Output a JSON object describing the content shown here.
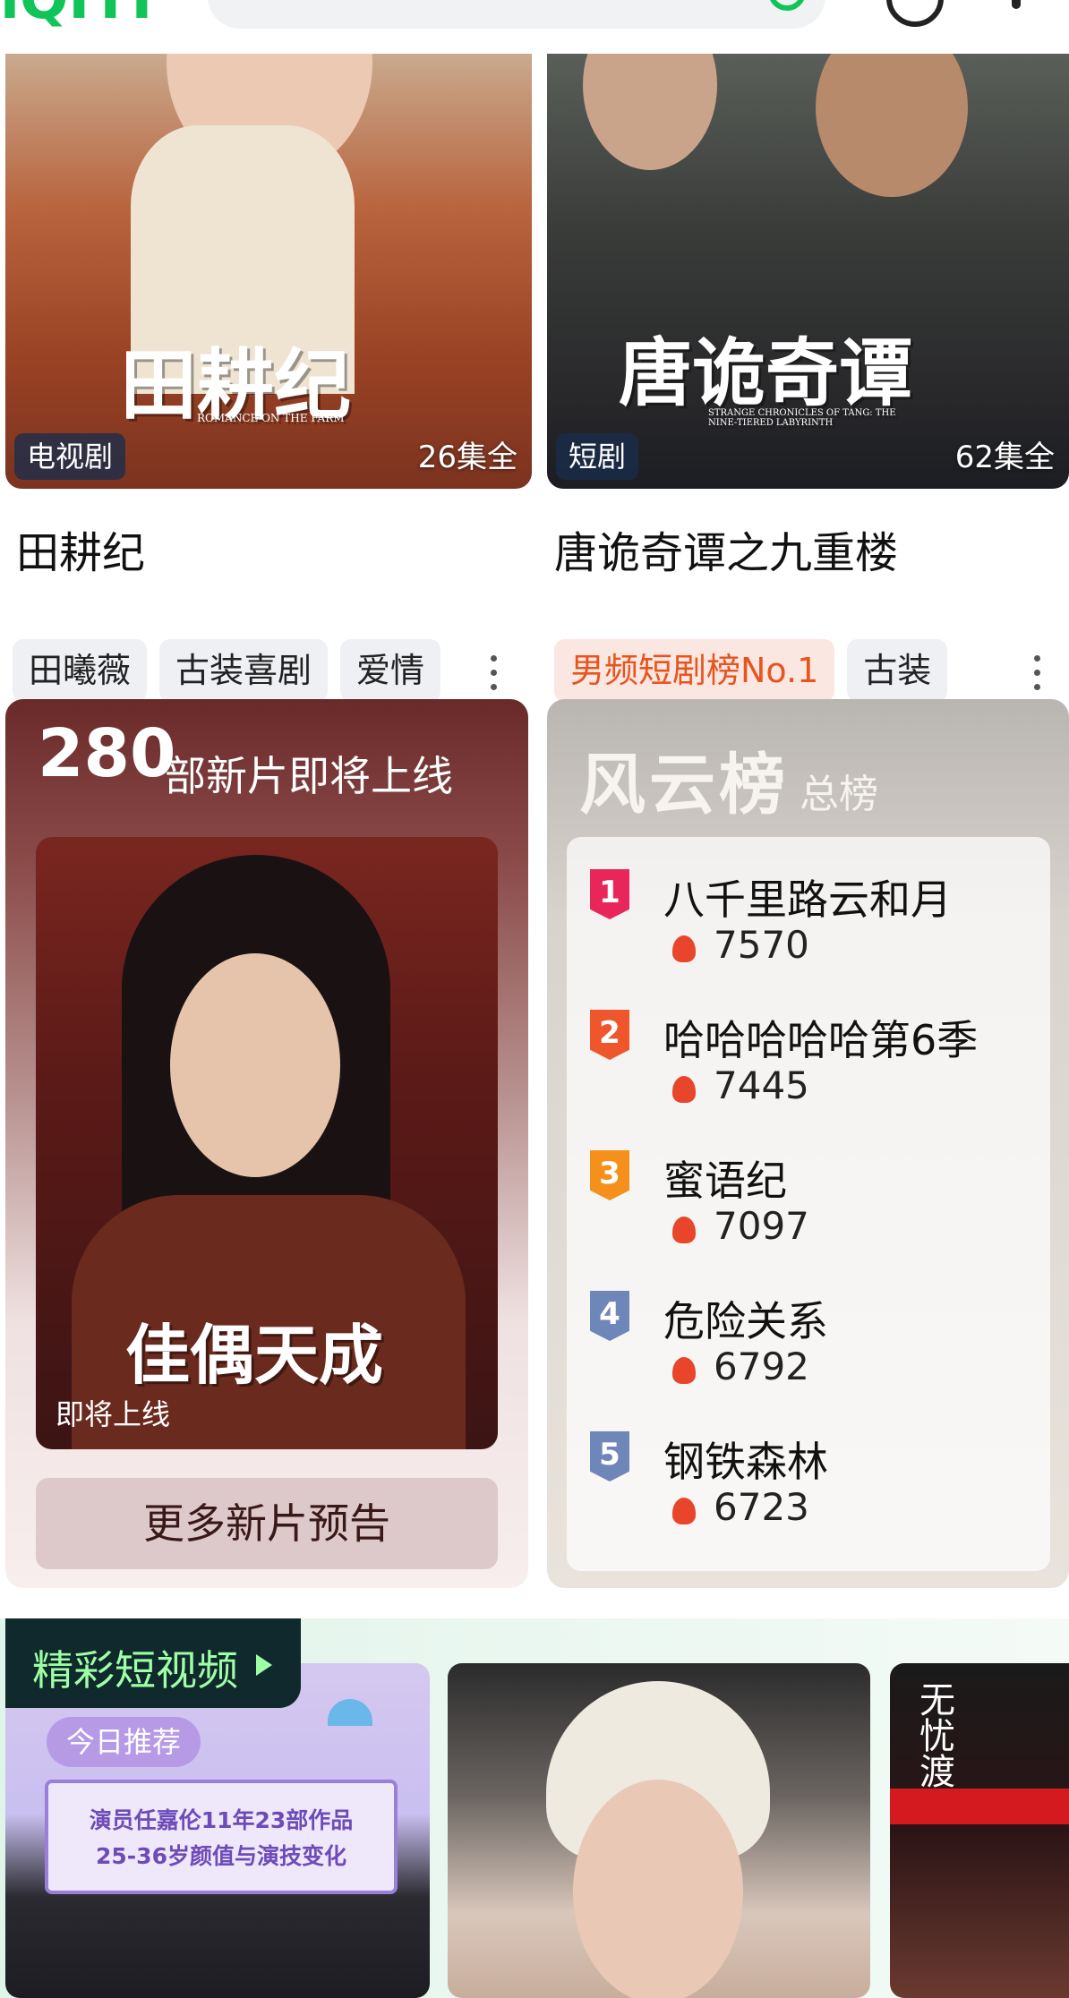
{
  "top_bar": {
    "logo": "iQIYI",
    "search_text": "",
    "icons": [
      "search-icon",
      "history-icon",
      "more-icon"
    ]
  },
  "cards": [
    {
      "title": "田耕纪",
      "type_badge": "电视剧",
      "episode_count": "26集全",
      "poster_calligraphy": "田耕纪",
      "poster_subtitle": "ROMANCE ON THE FARM",
      "tags": [
        "田曦薇",
        "古装喜剧",
        "爱情"
      ]
    },
    {
      "title": "唐诡奇谭之九重楼",
      "type_badge": "短剧",
      "episode_count": "62集全",
      "poster_calligraphy": "唐诡奇谭",
      "poster_subtitle": "STRANGE CHRONICLES OF TANG: THE NINE-TIERED LABYRINTH",
      "tags_hot": "男频短剧榜No.1",
      "tags": [
        "古装"
      ]
    }
  ],
  "upcoming": {
    "count": "280",
    "headline": "部新片即将上线",
    "poster_calligraphy": "佳偶天成",
    "coming_label": "即将上线",
    "more_button": "更多新片预告"
  },
  "ranking": {
    "title": "风云榜",
    "subtitle": "总榜",
    "items": [
      {
        "rank": "1",
        "name": "八千里路云和月",
        "heat": "7570",
        "color": "#e8265a"
      },
      {
        "rank": "2",
        "name": "哈哈哈哈哈第6季",
        "heat": "7445",
        "color": "#f0562c"
      },
      {
        "rank": "3",
        "name": "蜜语纪",
        "heat": "7097",
        "color": "#f5901c"
      },
      {
        "rank": "4",
        "name": "危险关系",
        "heat": "6792",
        "color": "#6f86b8"
      },
      {
        "rank": "5",
        "name": "钢铁森林",
        "heat": "6723",
        "color": "#6f86b8"
      }
    ]
  },
  "shorts": {
    "label": "精彩短视频",
    "thumb_a": {
      "badge": "今日推荐",
      "caption_line1": "演员任嘉伦11年23部作品",
      "caption_line2": "25-36岁颜值与演技变化"
    },
    "thumb_c": {
      "vertical_text": "无忧渡"
    }
  }
}
